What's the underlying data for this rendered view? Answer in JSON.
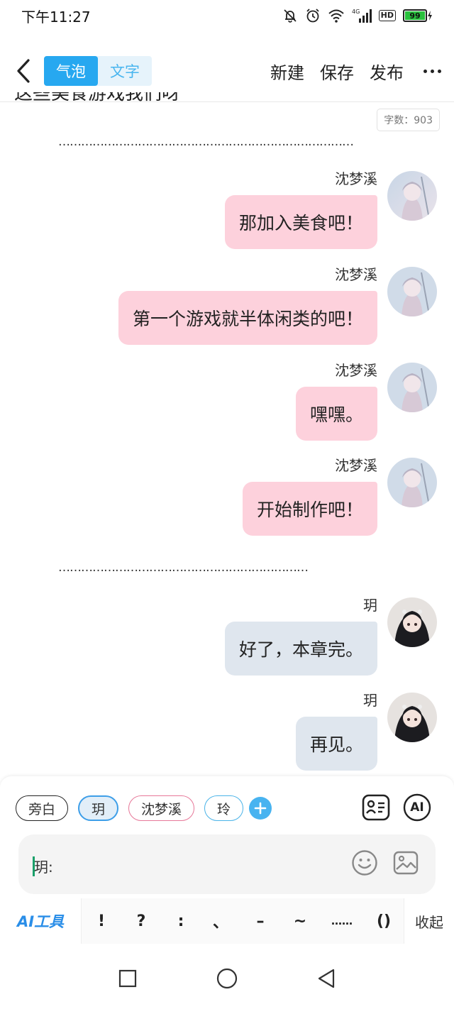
{
  "status_bar": {
    "time": "下午11:27",
    "network": "4G",
    "hd": "HD",
    "battery": "99"
  },
  "header": {
    "modes": [
      {
        "label": "气泡"
      },
      {
        "label": "文字"
      }
    ],
    "actions": [
      {
        "label": "新建"
      },
      {
        "label": "保存"
      },
      {
        "label": "发布"
      }
    ]
  },
  "content": {
    "clipped_text": "这些美食游戏我们呀",
    "word_count": "字数：903",
    "separator1": "……………………………………………………………………",
    "separator2": "…………………………………………………………",
    "messages": [
      {
        "name": "沈梦溪",
        "text": "那加入美食吧！",
        "style": "pink",
        "avatar": "sheng-mengxi-avatar"
      },
      {
        "name": "沈梦溪",
        "text": "第一个游戏就半体闲类的吧！",
        "style": "pink",
        "avatar": "sheng-mengxi-avatar"
      },
      {
        "name": "沈梦溪",
        "text": "嘿嘿。",
        "style": "pink",
        "avatar": "sheng-mengxi-avatar"
      },
      {
        "name": "沈梦溪",
        "text": "开始制作吧！",
        "style": "pink",
        "avatar": "sheng-mengxi-avatar"
      },
      {
        "name": "玥",
        "text": "好了，本章完。",
        "style": "grey",
        "avatar": "yue-avatar"
      },
      {
        "name": "玥",
        "text": "再见。",
        "style": "grey",
        "avatar": "yue-avatar"
      }
    ]
  },
  "input_panel": {
    "roles": [
      {
        "label": "旁白"
      },
      {
        "label": "玥"
      },
      {
        "label": "沈梦溪"
      },
      {
        "label": "玲"
      }
    ],
    "ai_button": "AI",
    "input_value": "玥:",
    "ai_tools": "AI工具",
    "punctuation": [
      "!",
      "?",
      ":",
      "、",
      "–",
      "~",
      "……",
      "()"
    ],
    "collapse": "收起"
  },
  "colors": {
    "accent": "#27a8f0",
    "pink_bubble": "#fdd1dc",
    "grey_bubble": "#dfe6ee"
  }
}
